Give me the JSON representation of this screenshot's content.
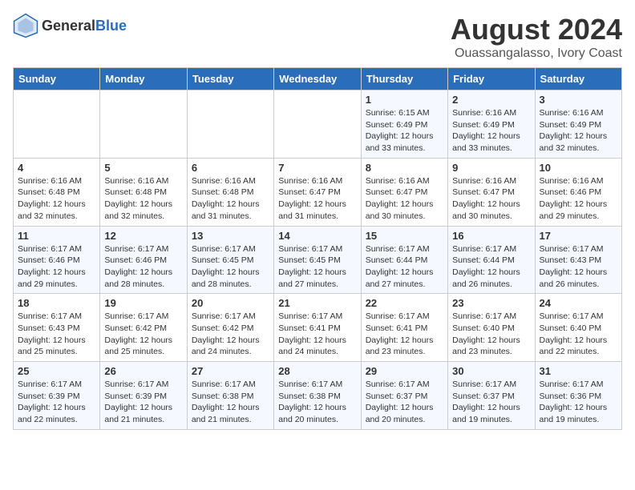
{
  "header": {
    "logo_general": "General",
    "logo_blue": "Blue",
    "main_title": "August 2024",
    "subtitle": "Ouassangalasso, Ivory Coast"
  },
  "days_of_week": [
    "Sunday",
    "Monday",
    "Tuesday",
    "Wednesday",
    "Thursday",
    "Friday",
    "Saturday"
  ],
  "weeks": [
    [
      {
        "day": "",
        "info": ""
      },
      {
        "day": "",
        "info": ""
      },
      {
        "day": "",
        "info": ""
      },
      {
        "day": "",
        "info": ""
      },
      {
        "day": "1",
        "info": "Sunrise: 6:15 AM\nSunset: 6:49 PM\nDaylight: 12 hours\nand 33 minutes."
      },
      {
        "day": "2",
        "info": "Sunrise: 6:16 AM\nSunset: 6:49 PM\nDaylight: 12 hours\nand 33 minutes."
      },
      {
        "day": "3",
        "info": "Sunrise: 6:16 AM\nSunset: 6:49 PM\nDaylight: 12 hours\nand 32 minutes."
      }
    ],
    [
      {
        "day": "4",
        "info": "Sunrise: 6:16 AM\nSunset: 6:48 PM\nDaylight: 12 hours\nand 32 minutes."
      },
      {
        "day": "5",
        "info": "Sunrise: 6:16 AM\nSunset: 6:48 PM\nDaylight: 12 hours\nand 32 minutes."
      },
      {
        "day": "6",
        "info": "Sunrise: 6:16 AM\nSunset: 6:48 PM\nDaylight: 12 hours\nand 31 minutes."
      },
      {
        "day": "7",
        "info": "Sunrise: 6:16 AM\nSunset: 6:47 PM\nDaylight: 12 hours\nand 31 minutes."
      },
      {
        "day": "8",
        "info": "Sunrise: 6:16 AM\nSunset: 6:47 PM\nDaylight: 12 hours\nand 30 minutes."
      },
      {
        "day": "9",
        "info": "Sunrise: 6:16 AM\nSunset: 6:47 PM\nDaylight: 12 hours\nand 30 minutes."
      },
      {
        "day": "10",
        "info": "Sunrise: 6:16 AM\nSunset: 6:46 PM\nDaylight: 12 hours\nand 29 minutes."
      }
    ],
    [
      {
        "day": "11",
        "info": "Sunrise: 6:17 AM\nSunset: 6:46 PM\nDaylight: 12 hours\nand 29 minutes."
      },
      {
        "day": "12",
        "info": "Sunrise: 6:17 AM\nSunset: 6:46 PM\nDaylight: 12 hours\nand 28 minutes."
      },
      {
        "day": "13",
        "info": "Sunrise: 6:17 AM\nSunset: 6:45 PM\nDaylight: 12 hours\nand 28 minutes."
      },
      {
        "day": "14",
        "info": "Sunrise: 6:17 AM\nSunset: 6:45 PM\nDaylight: 12 hours\nand 27 minutes."
      },
      {
        "day": "15",
        "info": "Sunrise: 6:17 AM\nSunset: 6:44 PM\nDaylight: 12 hours\nand 27 minutes."
      },
      {
        "day": "16",
        "info": "Sunrise: 6:17 AM\nSunset: 6:44 PM\nDaylight: 12 hours\nand 26 minutes."
      },
      {
        "day": "17",
        "info": "Sunrise: 6:17 AM\nSunset: 6:43 PM\nDaylight: 12 hours\nand 26 minutes."
      }
    ],
    [
      {
        "day": "18",
        "info": "Sunrise: 6:17 AM\nSunset: 6:43 PM\nDaylight: 12 hours\nand 25 minutes."
      },
      {
        "day": "19",
        "info": "Sunrise: 6:17 AM\nSunset: 6:42 PM\nDaylight: 12 hours\nand 25 minutes."
      },
      {
        "day": "20",
        "info": "Sunrise: 6:17 AM\nSunset: 6:42 PM\nDaylight: 12 hours\nand 24 minutes."
      },
      {
        "day": "21",
        "info": "Sunrise: 6:17 AM\nSunset: 6:41 PM\nDaylight: 12 hours\nand 24 minutes."
      },
      {
        "day": "22",
        "info": "Sunrise: 6:17 AM\nSunset: 6:41 PM\nDaylight: 12 hours\nand 23 minutes."
      },
      {
        "day": "23",
        "info": "Sunrise: 6:17 AM\nSunset: 6:40 PM\nDaylight: 12 hours\nand 23 minutes."
      },
      {
        "day": "24",
        "info": "Sunrise: 6:17 AM\nSunset: 6:40 PM\nDaylight: 12 hours\nand 22 minutes."
      }
    ],
    [
      {
        "day": "25",
        "info": "Sunrise: 6:17 AM\nSunset: 6:39 PM\nDaylight: 12 hours\nand 22 minutes."
      },
      {
        "day": "26",
        "info": "Sunrise: 6:17 AM\nSunset: 6:39 PM\nDaylight: 12 hours\nand 21 minutes."
      },
      {
        "day": "27",
        "info": "Sunrise: 6:17 AM\nSunset: 6:38 PM\nDaylight: 12 hours\nand 21 minutes."
      },
      {
        "day": "28",
        "info": "Sunrise: 6:17 AM\nSunset: 6:38 PM\nDaylight: 12 hours\nand 20 minutes."
      },
      {
        "day": "29",
        "info": "Sunrise: 6:17 AM\nSunset: 6:37 PM\nDaylight: 12 hours\nand 20 minutes."
      },
      {
        "day": "30",
        "info": "Sunrise: 6:17 AM\nSunset: 6:37 PM\nDaylight: 12 hours\nand 19 minutes."
      },
      {
        "day": "31",
        "info": "Sunrise: 6:17 AM\nSunset: 6:36 PM\nDaylight: 12 hours\nand 19 minutes."
      }
    ]
  ]
}
